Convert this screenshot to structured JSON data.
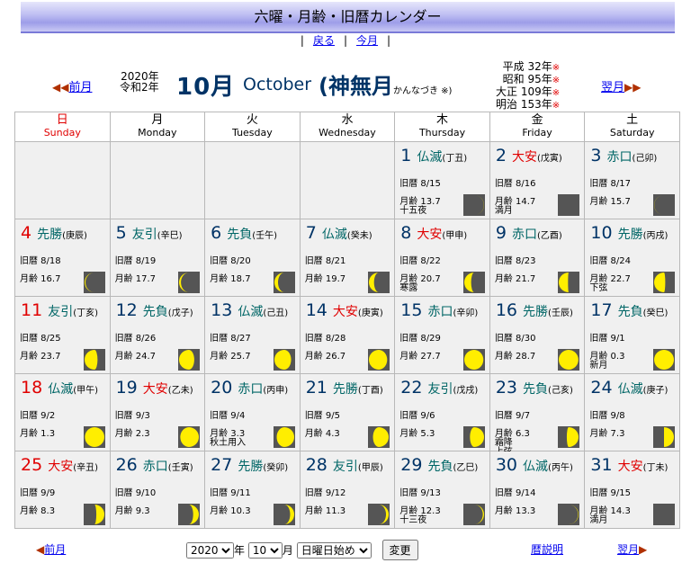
{
  "header": {
    "title": "六曜・月齢・旧暦カレンダー"
  },
  "nav": {
    "back": "戻る",
    "this_month": "今月"
  },
  "month_nav": {
    "prev": "前月",
    "next": "翌月"
  },
  "year_line1": "2020年",
  "year_line2": "令和2年",
  "month_jp": "10月",
  "month_en": "October",
  "month_old": "(神無月",
  "month_old_reading": "かんなづき ※)",
  "eras": [
    {
      "text": "平成 32年",
      "mark": "※"
    },
    {
      "text": "昭和 95年",
      "mark": "※"
    },
    {
      "text": "大正 109年",
      "mark": "※"
    },
    {
      "text": "明治 153年",
      "mark": "※"
    }
  ],
  "weekdays": [
    {
      "jp": "日",
      "en": "Sunday",
      "color": "#e00000"
    },
    {
      "jp": "月",
      "en": "Monday",
      "color": "#000000"
    },
    {
      "jp": "火",
      "en": "Tuesday",
      "color": "#000000"
    },
    {
      "jp": "水",
      "en": "Wednesday",
      "color": "#000000"
    },
    {
      "jp": "木",
      "en": "Thursday",
      "color": "#000000"
    },
    {
      "jp": "金",
      "en": "Friday",
      "color": "#000000"
    },
    {
      "jp": "土",
      "en": "Saturday",
      "color": "#000000"
    }
  ],
  "weeks": [
    [
      null,
      null,
      null,
      null,
      {
        "day": "1",
        "rokuyo": "仏滅",
        "kanshi": "(丁丑)",
        "kyureki": "旧暦 8/15",
        "moon_age": "月齢 13.7",
        "note": "十五夜",
        "phase": 0.47
      },
      {
        "day": "2",
        "rokuyo": "大安",
        "kanshi": "(戊寅)",
        "kyureki": "旧暦 8/16",
        "moon_age": "月齢 14.7",
        "note": "満月",
        "phase": 0.5
      },
      {
        "day": "3",
        "rokuyo": "赤口",
        "kanshi": "(己卯)",
        "kyureki": "旧暦 8/17",
        "moon_age": "月齢 15.7",
        "note": "",
        "phase": 0.53
      }
    ],
    [
      {
        "day": "4",
        "rokuyo": "先勝",
        "kanshi": "(庚辰)",
        "kyureki": "旧暦 8/18",
        "moon_age": "月齢 16.7",
        "note": "",
        "phase": 0.57
      },
      {
        "day": "5",
        "rokuyo": "友引",
        "kanshi": "(辛巳)",
        "kyureki": "旧暦 8/19",
        "moon_age": "月齢 17.7",
        "note": "",
        "phase": 0.6
      },
      {
        "day": "6",
        "rokuyo": "先負",
        "kanshi": "(壬午)",
        "kyureki": "旧暦 8/20",
        "moon_age": "月齢 18.7",
        "note": "",
        "phase": 0.64
      },
      {
        "day": "7",
        "rokuyo": "仏滅",
        "kanshi": "(癸未)",
        "kyureki": "旧暦 8/21",
        "moon_age": "月齢 19.7",
        "note": "",
        "phase": 0.67
      },
      {
        "day": "8",
        "rokuyo": "大安",
        "kanshi": "(甲申)",
        "kyureki": "旧暦 8/22",
        "moon_age": "月齢 20.7",
        "note": "寒露",
        "phase": 0.7
      },
      {
        "day": "9",
        "rokuyo": "赤口",
        "kanshi": "(乙酉)",
        "kyureki": "旧暦 8/23",
        "moon_age": "月齢 21.7",
        "note": "",
        "phase": 0.74
      },
      {
        "day": "10",
        "rokuyo": "先勝",
        "kanshi": "(丙戌)",
        "kyureki": "旧暦 8/24",
        "moon_age": "月齢 22.7",
        "note": "下弦",
        "phase": 0.77
      }
    ],
    [
      {
        "day": "11",
        "rokuyo": "友引",
        "kanshi": "(丁亥)",
        "kyureki": "旧暦 8/25",
        "moon_age": "月齢 23.7",
        "note": "",
        "phase": 0.8
      },
      {
        "day": "12",
        "rokuyo": "先負",
        "kanshi": "(戊子)",
        "kyureki": "旧暦 8/26",
        "moon_age": "月齢 24.7",
        "note": "",
        "phase": 0.84
      },
      {
        "day": "13",
        "rokuyo": "仏滅",
        "kanshi": "(己丑)",
        "kyureki": "旧暦 8/27",
        "moon_age": "月齢 25.7",
        "note": "",
        "phase": 0.87
      },
      {
        "day": "14",
        "rokuyo": "大安",
        "kanshi": "(庚寅)",
        "kyureki": "旧暦 8/28",
        "moon_age": "月齢 26.7",
        "note": "",
        "phase": 0.91
      },
      {
        "day": "15",
        "rokuyo": "赤口",
        "kanshi": "(辛卯)",
        "kyureki": "旧暦 8/29",
        "moon_age": "月齢 27.7",
        "note": "",
        "phase": 0.94
      },
      {
        "day": "16",
        "rokuyo": "先勝",
        "kanshi": "(壬辰)",
        "kyureki": "旧暦 8/30",
        "moon_age": "月齢 28.7",
        "note": "",
        "phase": 0.97
      },
      {
        "day": "17",
        "rokuyo": "先負",
        "kanshi": "(癸巳)",
        "kyureki": "旧暦 9/1",
        "moon_age": "月齢 0.3",
        "note": "新月",
        "phase": 0.01
      }
    ],
    [
      {
        "day": "18",
        "rokuyo": "仏滅",
        "kanshi": "(甲午)",
        "kyureki": "旧暦 9/2",
        "moon_age": "月齢 1.3",
        "note": "",
        "phase": 0.04
      },
      {
        "day": "19",
        "rokuyo": "大安",
        "kanshi": "(乙未)",
        "kyureki": "旧暦 9/3",
        "moon_age": "月齢 2.3",
        "note": "",
        "phase": 0.08
      },
      {
        "day": "20",
        "rokuyo": "赤口",
        "kanshi": "(丙申)",
        "kyureki": "旧暦 9/4",
        "moon_age": "月齢 3.3",
        "note": "秋土用入",
        "phase": 0.11
      },
      {
        "day": "21",
        "rokuyo": "先勝",
        "kanshi": "(丁酉)",
        "kyureki": "旧暦 9/5",
        "moon_age": "月齢 4.3",
        "note": "",
        "phase": 0.15
      },
      {
        "day": "22",
        "rokuyo": "友引",
        "kanshi": "(戊戌)",
        "kyureki": "旧暦 9/6",
        "moon_age": "月齢 5.3",
        "note": "",
        "phase": 0.18
      },
      {
        "day": "23",
        "rokuyo": "先負",
        "kanshi": "(己亥)",
        "kyureki": "旧暦 9/7",
        "moon_age": "月齢 6.3",
        "note": "霜降\n上弦",
        "phase": 0.22
      },
      {
        "day": "24",
        "rokuyo": "仏滅",
        "kanshi": "(庚子)",
        "kyureki": "旧暦 9/8",
        "moon_age": "月齢 7.3",
        "note": "",
        "phase": 0.25
      }
    ],
    [
      {
        "day": "25",
        "rokuyo": "大安",
        "kanshi": "(辛丑)",
        "kyureki": "旧暦 9/9",
        "moon_age": "月齢 8.3",
        "note": "",
        "phase": 0.28
      },
      {
        "day": "26",
        "rokuyo": "赤口",
        "kanshi": "(壬寅)",
        "kyureki": "旧暦 9/10",
        "moon_age": "月齢 9.3",
        "note": "",
        "phase": 0.32
      },
      {
        "day": "27",
        "rokuyo": "先勝",
        "kanshi": "(癸卯)",
        "kyureki": "旧暦 9/11",
        "moon_age": "月齢 10.3",
        "note": "",
        "phase": 0.35
      },
      {
        "day": "28",
        "rokuyo": "友引",
        "kanshi": "(甲辰)",
        "kyureki": "旧暦 9/12",
        "moon_age": "月齢 11.3",
        "note": "",
        "phase": 0.38
      },
      {
        "day": "29",
        "rokuyo": "先負",
        "kanshi": "(乙巳)",
        "kyureki": "旧暦 9/13",
        "moon_age": "月齢 12.3",
        "note": "十三夜",
        "phase": 0.42
      },
      {
        "day": "30",
        "rokuyo": "仏滅",
        "kanshi": "(丙午)",
        "kyureki": "旧暦 9/14",
        "moon_age": "月齢 13.3",
        "note": "",
        "phase": 0.45
      },
      {
        "day": "31",
        "rokuyo": "大安",
        "kanshi": "(丁未)",
        "kyureki": "旧暦 9/15",
        "moon_age": "月齢 14.3",
        "note": "満月",
        "phase": 0.49
      }
    ]
  ],
  "rokuyo_colors": {
    "大安": "#e00000",
    "仏滅": "#006666",
    "先勝": "#006666",
    "友引": "#006666",
    "先負": "#006666",
    "赤口": "#006666"
  },
  "footer": {
    "prev": "前月",
    "year_value": "2020",
    "year_suffix": "年",
    "month_value": "10",
    "month_suffix": "月",
    "week_start": "日曜日始め",
    "change_button": "変更",
    "explanation": "暦説明",
    "next": "翌月"
  }
}
